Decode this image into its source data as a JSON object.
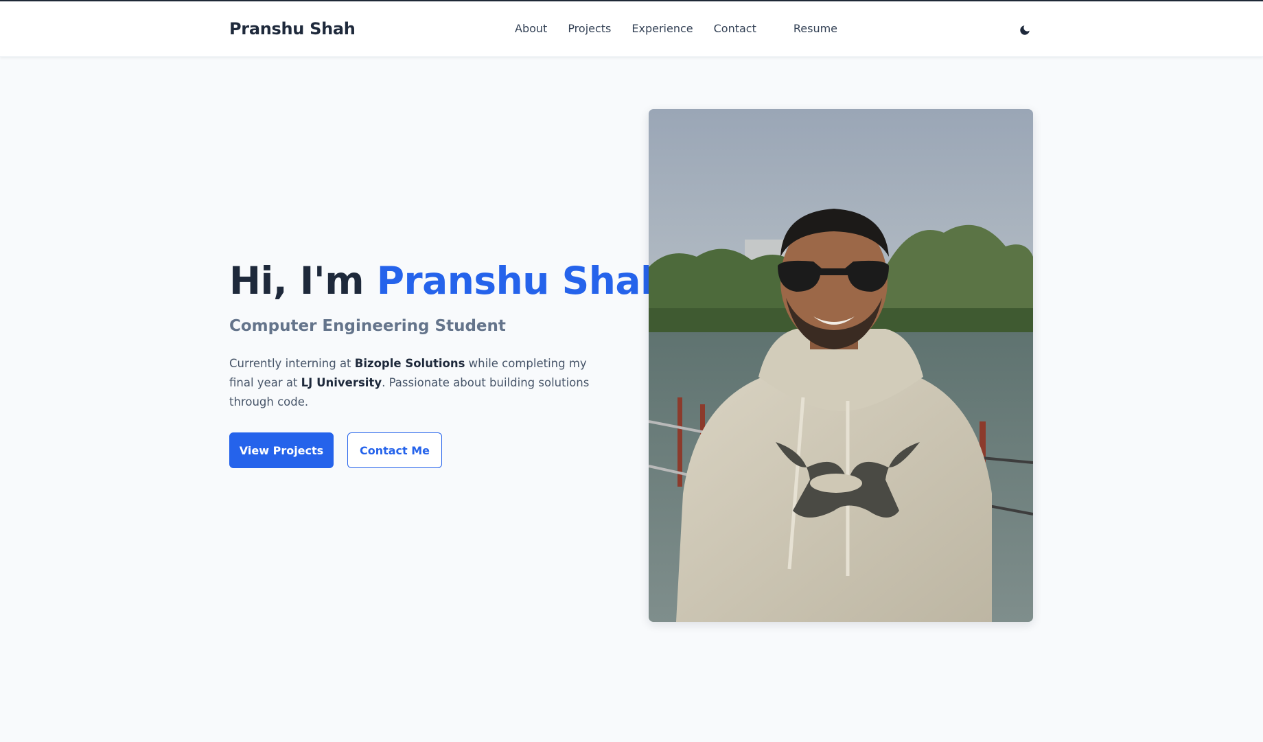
{
  "header": {
    "brand": "Pranshu Shah",
    "nav": {
      "about": "About",
      "projects": "Projects",
      "experience": "Experience",
      "contact": "Contact",
      "resume": "Resume"
    },
    "theme_toggle_icon": "moon-icon"
  },
  "hero": {
    "greeting": "Hi, I'm ",
    "name": "Pranshu Shah",
    "subtitle": "Computer Engineering Student",
    "description": {
      "part1": "Currently interning at ",
      "company": "Bizople Solutions",
      "part2": " while completing my final year at ",
      "university": "LJ University",
      "part3": ". Passionate about building solutions through code."
    },
    "primary_button": "View Projects",
    "secondary_button": "Contact Me",
    "photo_description": "profile-photo"
  },
  "colors": {
    "accent": "#2563eb",
    "text_dark": "#1e293b",
    "text_muted": "#64748b",
    "background": "#f8fafc"
  }
}
